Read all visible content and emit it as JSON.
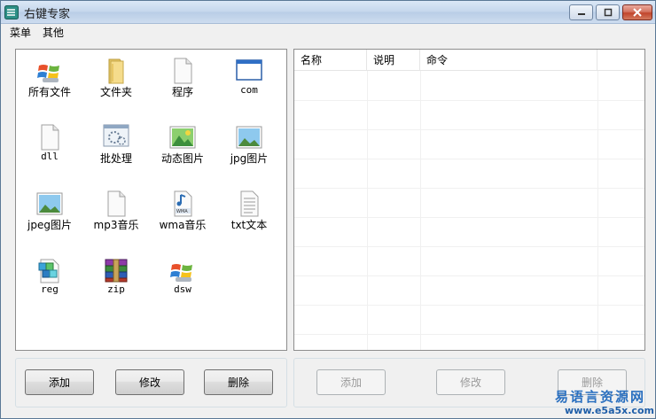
{
  "window": {
    "title": "右键专家",
    "menu": [
      "菜单",
      "其他"
    ]
  },
  "icons": [
    {
      "label": "所有文件",
      "icon": "windows-logo-icon"
    },
    {
      "label": "文件夹",
      "icon": "folder-icon"
    },
    {
      "label": "程序",
      "icon": "blank-file-icon"
    },
    {
      "label": "com",
      "icon": "window-app-icon"
    },
    {
      "label": "dll",
      "icon": "blank-file-icon"
    },
    {
      "label": "批处理",
      "icon": "batch-file-icon"
    },
    {
      "label": "动态图片",
      "icon": "gif-image-icon"
    },
    {
      "label": "jpg图片",
      "icon": "jpg-image-icon"
    },
    {
      "label": "jpeg图片",
      "icon": "jpeg-image-icon"
    },
    {
      "label": "mp3音乐",
      "icon": "blank-file-icon"
    },
    {
      "label": "wma音乐",
      "icon": "wma-audio-icon"
    },
    {
      "label": "txt文本",
      "icon": "text-file-icon"
    },
    {
      "label": "reg",
      "icon": "registry-file-icon"
    },
    {
      "label": "zip",
      "icon": "winrar-archive-icon"
    },
    {
      "label": "dsw",
      "icon": "windows-logo-icon"
    }
  ],
  "list": {
    "columns": [
      "名称",
      "说明",
      "命令"
    ],
    "rows": []
  },
  "left_buttons": {
    "add": "添加",
    "edit": "修改",
    "delete": "删除"
  },
  "right_buttons": {
    "add": "添加",
    "edit": "修改",
    "delete": "删除"
  },
  "watermark": {
    "line1": "易语言资源网",
    "line2": "www.e5a5x.com"
  },
  "colors": {
    "title_bar": "#c4d6ec",
    "close_button": "#c1452c",
    "watermark": "#2a6fbf"
  }
}
